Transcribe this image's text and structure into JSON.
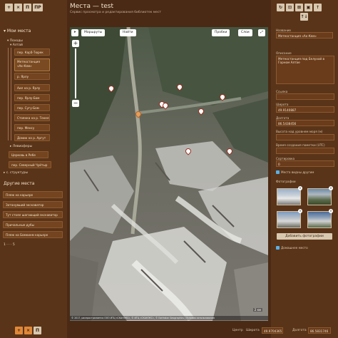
{
  "toolbar": {
    "btn1": "+",
    "btn2": "×",
    "btn3": "П",
    "btn4": "ПР"
  },
  "right_toolbar": {
    "btn1": "↻",
    "btn2": "⊡",
    "btn3": "⊠",
    "btn4": "▣",
    "btn5": "↑",
    "btn6": "↑↓"
  },
  "header": {
    "title": "Места — test",
    "subtitle": "Сервис просмотра и редактирования библиотек мест"
  },
  "sidebar": {
    "my_places": "Мои места",
    "tree": {
      "pohody": "Походы",
      "altai": "Алтай",
      "items": [
        "пер. Карå-Тюрек",
        "Метеостанция «Ак-Кем»",
        "р. Ярлу",
        "Аил на р. Ярлу",
        "пер. Ярлу-Бом",
        "пер. Сугу-Бом",
        "Стоянка на р. Текелю",
        "пер. Менсу",
        "Домик на р. Аргут"
      ],
      "leviofery": "Левиоферы",
      "church": "Церковь в Ребе",
      "north_chuy": "пер. Северный Чуйтыр",
      "structures": "с. структуры"
    },
    "other_places": "Другие места",
    "other_items": [
      "Пляж на карьере",
      "Затонувший экскаватор",
      "Тут стоял шагающий экскаватор",
      "Причальные дубы",
      "Пляж на Бомкинм карьере"
    ],
    "pagination": "1 · · · 5"
  },
  "map": {
    "routes_label": "Маршруты",
    "find_label": "Найти",
    "traffic_label": "Пробки",
    "layers_label": "Слои",
    "zoom_in": "+",
    "zoom_out": "−",
    "scale": "2 км",
    "attribution": "© 2017, распространяется ООО ИТЦ «СКАНЭКС», © ИТЦ «СКАНЭКС», © Earthstar Geographics | Условия использования"
  },
  "details": {
    "name_label": "Название",
    "name_value": "Метеостанция «Ак-Кем»",
    "desc_label": "Описание",
    "desc_value": "Метеостанция под Белухой в Горном Алтае",
    "link_label": "Ссылка",
    "lat_label": "Широта",
    "lat_value": "49.9140887",
    "lon_label": "Долгота",
    "lon_value": "86.5438456",
    "alt_label": "Высота над уровнем моря (м)",
    "time_label": "Время создания пометки (UTC)",
    "sort_label": "Сортировка",
    "sort_value": "0",
    "other_places_check": "Места видны другим",
    "photos_label": "Фотографии",
    "add_photo": "Добавить фотографии",
    "home_place": "Домашнее место"
  },
  "footer": {
    "center_label": "Центр",
    "lat_label": "Широта",
    "lat_value": "49.9704365",
    "lon_label": "Долгота",
    "lon_value": "86.5831746"
  },
  "bottom_toolbar": {
    "btn1": "+",
    "btn2": "×",
    "btn3": "П"
  }
}
